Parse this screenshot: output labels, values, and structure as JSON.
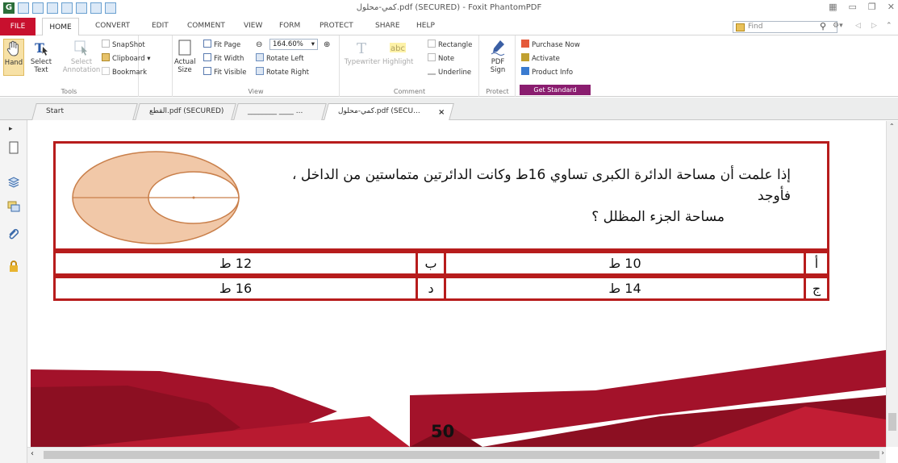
{
  "window": {
    "title": "كمي-محلول.pdf (SECURED) - Foxit PhantomPDF",
    "app_icon_letter": "G"
  },
  "menu": {
    "file": "FILE",
    "home": "HOME",
    "convert": "CONVERT",
    "edit": "EDIT",
    "comment": "COMMENT",
    "view": "VIEW",
    "form": "FORM",
    "protect": "PROTECT",
    "share": "SHARE",
    "help": "HELP",
    "find_placeholder": "Find"
  },
  "ribbon": {
    "tools": {
      "label": "Tools",
      "hand": "Hand",
      "select_text_1": "Select",
      "select_text_2": "Text",
      "select_annotation_1": "Select",
      "select_annotation_2": "Annotation",
      "snapshot": "SnapShot",
      "clipboard": "Clipboard ▾",
      "bookmark": "Bookmark"
    },
    "view": {
      "label": "View",
      "actual_size_1": "Actual",
      "actual_size_2": "Size",
      "fit_page": "Fit Page",
      "fit_width": "Fit Width",
      "fit_visible": "Fit Visible",
      "zoom": "164.60%",
      "rotate_left": "Rotate Left",
      "rotate_right": "Rotate Right"
    },
    "comment": {
      "label": "Comment",
      "typewriter": "Typewriter",
      "highlight": "Highlight",
      "rectangle": "Rectangle",
      "note": "Note",
      "underline": "Underline"
    },
    "protect": {
      "label": "Protect",
      "pdf_sign_1": "PDF",
      "pdf_sign_2": "Sign"
    },
    "standard": {
      "label": "Get Standard",
      "purchase": "Purchase Now",
      "activate": "Activate",
      "product_info": "Product Info"
    }
  },
  "tabs": [
    {
      "label": "Start"
    },
    {
      "label": "القطع.pdf (SECURED)"
    },
    {
      "label": "________ ____ ..."
    },
    {
      "label": "كمي-محلول.pdf (SECU..."
    }
  ],
  "question": {
    "text_line1": "إذا علمت أن مساحة الدائرة الكبرى تساوي 16ط وكانت الدائرتين متماستين من الداخل ، فأوجد",
    "text_line2": "مساحة الجزء المظلل ؟"
  },
  "answers": [
    {
      "letter_a": "أ",
      "value_a": "10 ط",
      "letter_b": "ب",
      "value_b": "12 ط"
    },
    {
      "letter_a": "ج",
      "value_a": "14 ط",
      "letter_b": "د",
      "value_b": "16 ط"
    }
  ],
  "page_number": "50",
  "colors": {
    "accent": "#c8102e",
    "frame": "#b71c1c",
    "standard": "#8a1d6f"
  }
}
